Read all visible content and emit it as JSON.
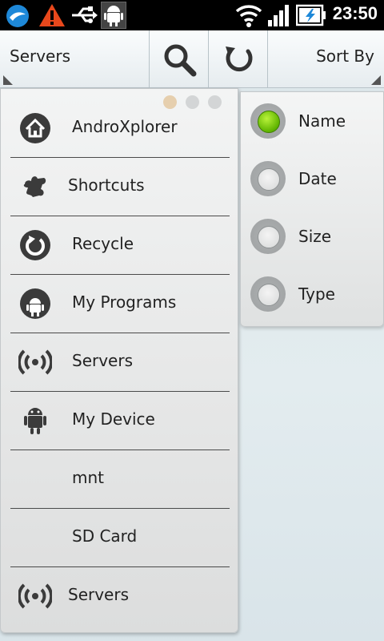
{
  "status_bar": {
    "time": "23:50",
    "icons": [
      "kite-app-icon",
      "warning-icon",
      "usb-icon",
      "android-debug-icon",
      "wifi-icon",
      "signal-icon",
      "battery-charging-icon"
    ]
  },
  "toolbar": {
    "left_label": "Servers",
    "right_label": "Sort By",
    "search_icon": "search-icon",
    "refresh_icon": "refresh-icon"
  },
  "nav": {
    "items": [
      {
        "label": "AndroXplorer",
        "icon": "home-icon"
      },
      {
        "label": "Shortcuts",
        "icon": "puzzle-icon"
      },
      {
        "label": "Recycle",
        "icon": "recycle-icon"
      },
      {
        "label": "My Programs",
        "icon": "android-apps-icon"
      },
      {
        "label": "Servers",
        "icon": "broadcast-icon"
      },
      {
        "label": "My Device",
        "icon": "android-icon"
      },
      {
        "label": "mnt",
        "icon": ""
      },
      {
        "label": "SD Card",
        "icon": ""
      },
      {
        "label": "Servers",
        "icon": "broadcast-icon"
      }
    ],
    "page_indicator": {
      "count": 3,
      "active": 0
    }
  },
  "sort": {
    "options": [
      {
        "label": "Name",
        "checked": true
      },
      {
        "label": "Date",
        "checked": false
      },
      {
        "label": "Size",
        "checked": false
      },
      {
        "label": "Type",
        "checked": false
      }
    ]
  },
  "colors": {
    "accent_green": "#5fb400",
    "status_bar": "#000000",
    "divider": "#4a4a4a"
  }
}
